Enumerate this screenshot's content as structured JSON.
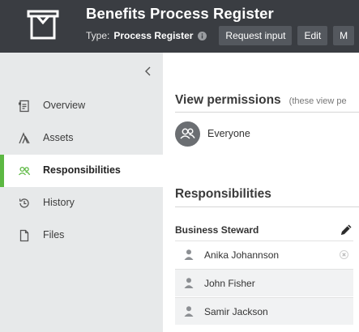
{
  "header": {
    "title": "Benefits Process Register",
    "type_key": "Type:",
    "type_value": "Process Register",
    "buttons": [
      {
        "label": "Request input"
      },
      {
        "label": "Edit"
      },
      {
        "label": "M"
      }
    ]
  },
  "sidebar": {
    "items": [
      {
        "label": "Overview",
        "icon": "overview-doc-icon"
      },
      {
        "label": "Assets",
        "icon": "assets-icon"
      },
      {
        "label": "Responsibilities",
        "icon": "people-icon",
        "active": true
      },
      {
        "label": "History",
        "icon": "history-icon"
      },
      {
        "label": "Files",
        "icon": "file-icon"
      }
    ]
  },
  "view_permissions": {
    "title": "View permissions",
    "note": "(these view pe",
    "everyone_label": "Everyone"
  },
  "responsibilities": {
    "title": "Responsibilities",
    "role": "Business Steward",
    "people": [
      {
        "name": "Anika Johannson"
      },
      {
        "name": "John Fisher"
      },
      {
        "name": "Samir Jackson"
      }
    ]
  },
  "colors": {
    "header_bg": "#3a3d42",
    "sidebar_bg": "#e7e9ea",
    "active_accent": "#5cb842",
    "button_bg": "#54585e"
  }
}
